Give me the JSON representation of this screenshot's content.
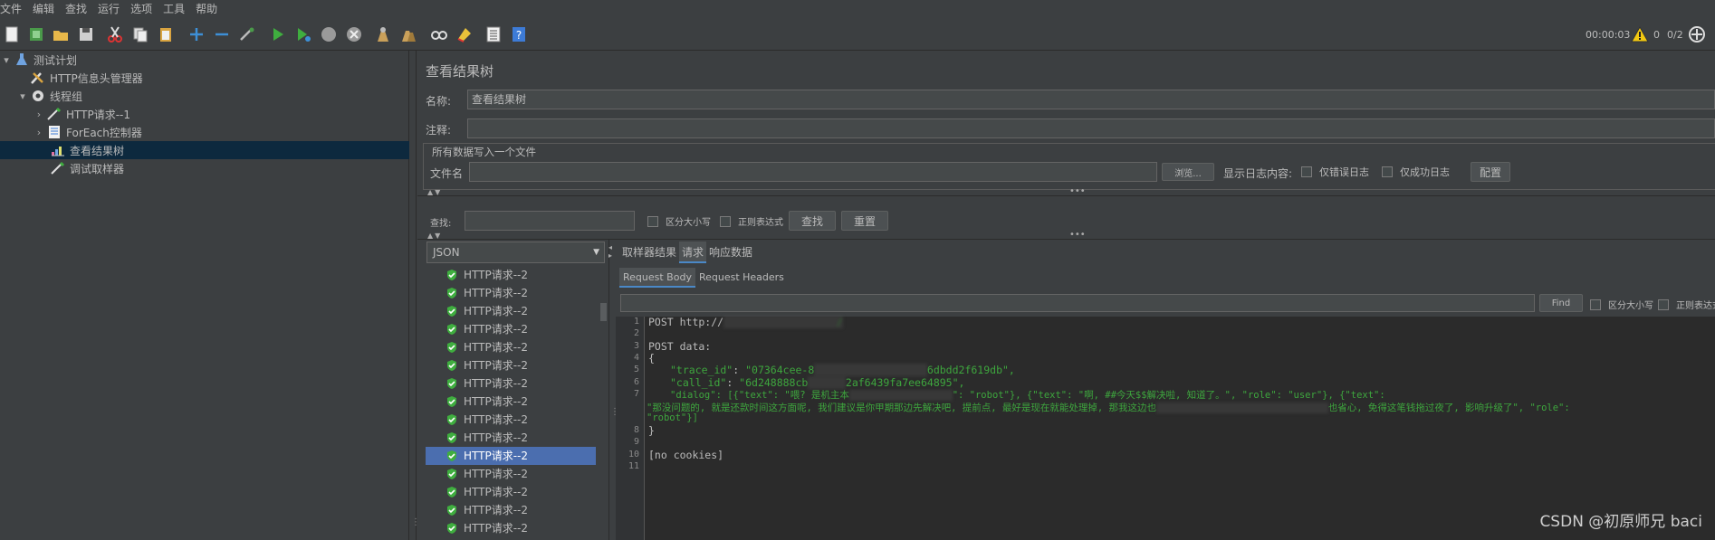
{
  "menu": [
    "文件",
    "编辑",
    "查找",
    "运行",
    "选项",
    "工具",
    "帮助"
  ],
  "toolbar": {
    "icons": [
      "new-icon",
      "templates-icon",
      "open-icon",
      "save-icon",
      "cut-icon",
      "copy-icon",
      "paste-icon",
      "expand-icon",
      "collapse-icon",
      "toggle-icon",
      "start-icon",
      "start-no-pause-icon",
      "stop-icon",
      "shutdown-icon",
      "clear-icon",
      "clear-all-icon",
      "search-icon",
      "reset-search-icon",
      "function-helper-icon",
      "help-icon"
    ],
    "timer": "00:00:03",
    "warnings": "0",
    "threads": "0/2"
  },
  "tree": [
    {
      "label": "测试计划",
      "icon": "flask-icon",
      "level": 0,
      "arrow": "▾"
    },
    {
      "label": "HTTP信息头管理器",
      "icon": "wrench-icon",
      "level": 1,
      "arrow": ""
    },
    {
      "label": "线程组",
      "icon": "gear-icon",
      "level": 1,
      "arrow": "▾"
    },
    {
      "label": "HTTP请求--1",
      "icon": "pipette-icon",
      "level": 2,
      "arrow": "›"
    },
    {
      "label": "ForEach控制器",
      "icon": "controller-icon",
      "level": 2,
      "arrow": "›"
    },
    {
      "label": "查看结果树",
      "icon": "chart-icon",
      "level": 2,
      "arrow": "",
      "selected": true
    },
    {
      "label": "调试取样器",
      "icon": "pipette-icon",
      "level": 2,
      "arrow": ""
    }
  ],
  "panel": {
    "title": "查看结果树",
    "name_label": "名称:",
    "name_value": "查看结果树",
    "comment_label": "注释:",
    "comment_value": "",
    "fieldset_legend": "所有数据写入一个文件",
    "filename_label": "文件名",
    "filename_value": "",
    "browse_button": "浏览...",
    "log_label": "显示日志内容:",
    "errors_only": "仅错误日志",
    "success_only": "仅成功日志",
    "configure_button": "配置",
    "search_label": "查找:",
    "search_value": "",
    "case_sensitive": "区分大小写",
    "regex": "正则表达式",
    "find_button": "查找",
    "reset_button": "重置"
  },
  "renderer": "JSON",
  "results": [
    "HTTP请求--2",
    "HTTP请求--2",
    "HTTP请求--2",
    "HTTP请求--2",
    "HTTP请求--2",
    "HTTP请求--2",
    "HTTP请求--2",
    "HTTP请求--2",
    "HTTP请求--2",
    "HTTP请求--2",
    "HTTP请求--2",
    "HTTP请求--2",
    "HTTP请求--2",
    "HTTP请求--2",
    "HTTP请求--2"
  ],
  "selected_result_index": 10,
  "tabs": [
    "取样器结果",
    "请求",
    "响应数据"
  ],
  "active_tab": 1,
  "subtabs": [
    "Request Body",
    "Request Headers"
  ],
  "active_subtab": 0,
  "find_bar": {
    "value": "",
    "find_button": "Find",
    "case_sensitive": "区分大小写",
    "regex": "正则表达式"
  },
  "code": {
    "line1": "POST http://",
    "line1_blur": "                  /",
    "line3": "POST data:",
    "line4": "{",
    "line5_key": "\"trace_id\"",
    "line5_val_a": "\"07364cee-8",
    "line5_val_blur": "                  ",
    "line5_val_b": "6dbdd2f619db\",",
    "line6_key": "\"call_id\"",
    "line6_val_a": "\"6d248888cb",
    "line6_val_blur": "      ",
    "line6_val_b": "2af6439fa7ee64895\",",
    "line7": "\"dialog\": [{\"text\": \"喂? 是机主本",
    "line7_blur": "                  ",
    "line7_b": "\": \"robot\"}, {\"text\": \"啊, ##今天$$解决啦, 知道了。\", \"role\": \"user\"}, {\"text\":",
    "line7c": "\"那没问题的, 就是还款时间这方面呢, 我们建议是你甲期那边先解决吧, 提前点, 最好是现在就能处理掉, 那我这边也",
    "line7c_blur": "                              ",
    "line7c_b": "也省心, 免得这笔钱拖过夜了, 影响升级了\", \"role\":",
    "line7d": "\"robot\"}]",
    "line8": "}",
    "line10": "[no cookies]",
    "line_numbers": [
      "1",
      "2",
      "3",
      "4",
      "5",
      "6",
      "7",
      "8",
      "9",
      "10",
      "11"
    ]
  },
  "watermark": "CSDN @初原师兄 baci"
}
